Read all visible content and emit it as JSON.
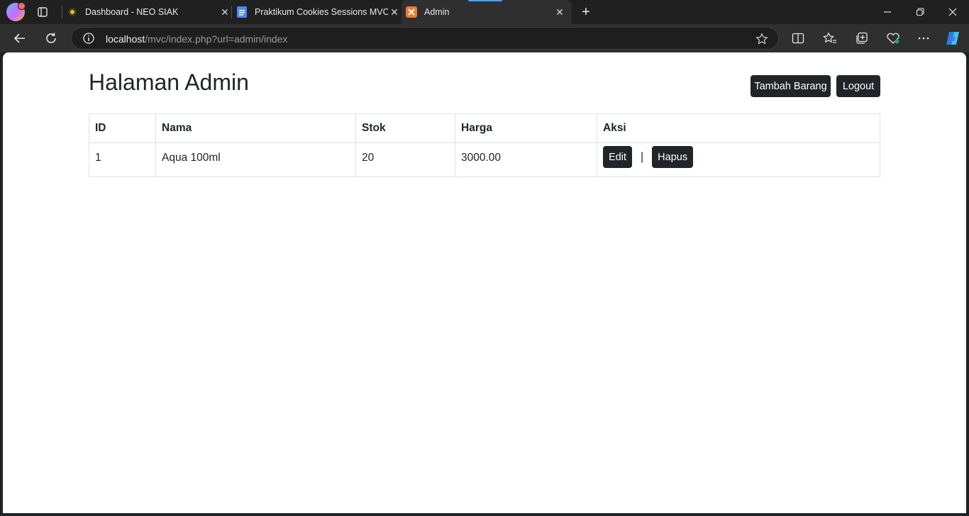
{
  "browser": {
    "tabs": [
      {
        "title": "Dashboard - NEO SIAK",
        "icon": "neo-siak-favicon",
        "active": false
      },
      {
        "title": "Praktikum Cookies Sessions MVC",
        "icon": "google-docs-favicon",
        "active": false
      },
      {
        "title": "Admin",
        "icon": "xampp-favicon",
        "active": true
      }
    ],
    "address": {
      "host": "localhost",
      "path": "/mvc/index.php?url=admin/index"
    },
    "accent_color": "#4aa3ff"
  },
  "page": {
    "title": "Halaman Admin",
    "add_button": "Tambah Barang",
    "logout_button": "Logout",
    "table": {
      "headers": {
        "id": "ID",
        "nama": "Nama",
        "stok": "Stok",
        "harga": "Harga",
        "aksi": "Aksi"
      },
      "rows": [
        {
          "id": "1",
          "nama": "Aqua 100ml",
          "stok": "20",
          "harga": "3000.00",
          "edit": "Edit",
          "separator": "|",
          "hapus": "Hapus"
        }
      ]
    },
    "button_color": "#212529"
  }
}
